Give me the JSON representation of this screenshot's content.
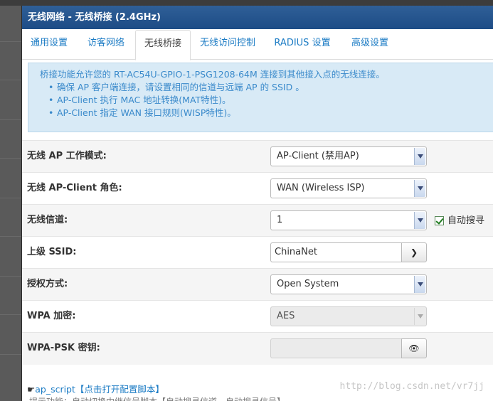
{
  "window": {
    "title": "无线网络 - 无线桥接 (2.4GHz)"
  },
  "tabs": [
    {
      "label": "通用设置"
    },
    {
      "label": "访客网络"
    },
    {
      "label": "无线桥接"
    },
    {
      "label": "无线访问控制"
    },
    {
      "label": "RADIUS 设置"
    },
    {
      "label": "高级设置"
    }
  ],
  "info": {
    "line": "桥接功能允许您的 RT-AC54U-GPIO-1-PSG1208-64M 连接到其他接入点的无线连接。",
    "bullets": [
      "确保 AP 客户端连接，请设置相同的信道与远端 AP 的 SSID 。",
      "AP-Client 执行 MAC 地址转换(MAT特性)。",
      "AP-Client 指定 WAN 接口规则(WISP特性)。"
    ]
  },
  "form": {
    "mode": {
      "label": "无线 AP 工作模式:",
      "value": "AP-Client (禁用AP)"
    },
    "role": {
      "label": "无线 AP-Client 角色:",
      "value": "WAN (Wireless ISP)"
    },
    "channel": {
      "label": "无线信道:",
      "value": "1",
      "auto_label": "自动搜寻"
    },
    "ssid": {
      "label": "上级 SSID:",
      "value": "ChinaNet"
    },
    "auth": {
      "label": "授权方式:",
      "value": "Open System"
    },
    "wpa": {
      "label": "WPA 加密:",
      "value": "AES"
    },
    "psk": {
      "label": "WPA-PSK 密钥:",
      "value": ""
    }
  },
  "footer": {
    "link": "ap_script【点击打开配置脚本】",
    "note": "提示功能：自动切换中继信号脚本【自动搜寻信道，自动搜寻信号】"
  },
  "watermark": "http://blog.csdn.net/vr7jj"
}
